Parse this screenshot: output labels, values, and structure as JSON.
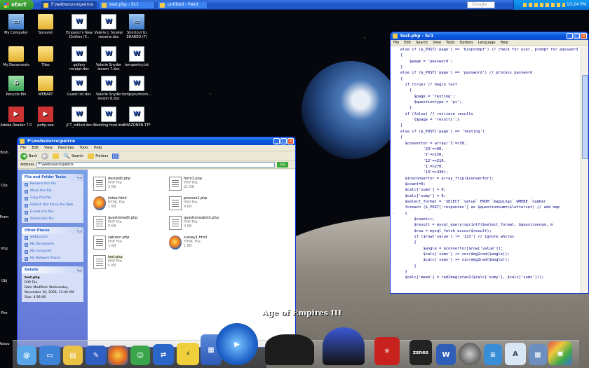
{
  "taskbar": {
    "start_label": "start",
    "tasks": [
      {
        "label": "F:\\websource\\peirce",
        "active": true
      },
      {
        "label": "test.php - Sc1",
        "active": false
      },
      {
        "label": "untitled - Paint",
        "active": false
      }
    ],
    "search_placeholder": "Google",
    "clock": "10:24 PM"
  },
  "desktop_icons": [
    {
      "label": "My Computer",
      "type": "comp"
    },
    {
      "label": "Spravist",
      "type": "folder"
    },
    {
      "label": "Emperor's New Clothes (F...",
      "type": "doc"
    },
    {
      "label": "Valerie J. Snyder resume.doc",
      "type": "doc"
    },
    {
      "label": "Shortcut to SHARED (F)",
      "type": "comp"
    },
    {
      "label": "My Documents",
      "type": "folder"
    },
    {
      "label": "Tiles",
      "type": "folder"
    },
    {
      "label": "gallery receipt.doc",
      "type": "doc"
    },
    {
      "label": "Valerie Snyder lesson 7.doc",
      "type": "doc"
    },
    {
      "label": "tempentry.txt",
      "type": "doc"
    },
    {
      "label": "Recycle Bin",
      "type": "bin"
    },
    {
      "label": "WEBART",
      "type": "folder"
    },
    {
      "label": "Guest list.doc",
      "type": "doc"
    },
    {
      "label": "Valerie Snyder lesson 8.doc",
      "type": "doc"
    },
    {
      "label": "tempyourmom...",
      "type": "doc"
    },
    {
      "label": "Adobe Reader 7.0",
      "type": "app"
    },
    {
      "label": "poftp.exe",
      "type": "app"
    },
    {
      "label": "JCT_edited.doc",
      "type": "doc"
    },
    {
      "label": "Wedding food.doc",
      "type": "doc"
    },
    {
      "label": "AMAZONEN.TTF",
      "type": "doc"
    }
  ],
  "left_edge_labels": [
    "Brsh",
    "Clip",
    "Fram",
    "Img",
    "Obj",
    "Pho",
    "Resou"
  ],
  "explorer": {
    "title": "F:\\websource\\peirce",
    "menu": [
      "File",
      "Edit",
      "View",
      "Favorites",
      "Tools",
      "Help"
    ],
    "toolbar": {
      "back": "Back",
      "search": "Search",
      "folders": "Folders"
    },
    "address_label": "Address",
    "address_value": "F:\\websource\\peirce",
    "go_label": "Go",
    "tasks_panel": {
      "title": "File and Folder Tasks",
      "items": [
        "Rename this file",
        "Move this file",
        "Copy this file",
        "Publish this file to the Web",
        "E-mail this file",
        "Delete this file"
      ]
    },
    "places_panel": {
      "title": "Other Places",
      "items": [
        "websource",
        "My Documents",
        "My Computer",
        "My Network Places"
      ]
    },
    "details_panel": {
      "title": "Details",
      "name": "test.php",
      "type": "PHP File",
      "modified": "Date Modified: Wednesday, November 30, 2005, 11:40 AM",
      "size": "Size: 4.96 KB"
    },
    "files": [
      {
        "name": "descedit.php",
        "type": "PHP File",
        "size": "2 KB",
        "icon": "doc"
      },
      {
        "name": "form1.php",
        "type": "PHP File",
        "size": "21 KB",
        "icon": "doc"
      },
      {
        "name": "index.html",
        "type": "HTML File",
        "size": "1 KB",
        "icon": "ff"
      },
      {
        "name": "process1.php",
        "type": "PHP File",
        "size": "4 KB",
        "icon": "doc"
      },
      {
        "name": "questionedit.php",
        "type": "PHP File",
        "size": "5 KB",
        "icon": "doc"
      },
      {
        "name": "questionsubmit.php",
        "type": "PHP File",
        "size": "2 KB",
        "icon": "doc"
      },
      {
        "name": "sqlconn.php",
        "type": "PHP File",
        "size": "1 KB",
        "icon": "doc"
      },
      {
        "name": "survey1.html",
        "type": "HTML File",
        "size": "1 KB",
        "icon": "ff"
      },
      {
        "name": "test.php",
        "type": "PHP File",
        "size": "5 KB",
        "icon": "doc"
      }
    ]
  },
  "editor": {
    "title": "test.php - Sc1",
    "menu": [
      "File",
      "Edit",
      "Search",
      "View",
      "Tools",
      "Options",
      "Language",
      "Help"
    ],
    "lines": [
      {
        "fold": "",
        "text": "else if ($_POST['page'] == 'bioprompt') // check for user, prompt for password"
      },
      {
        "fold": "-",
        "text": "{"
      },
      {
        "fold": "",
        "text": "    $page = 'password';"
      },
      {
        "fold": "",
        "text": ""
      },
      {
        "fold": "",
        "text": "}"
      },
      {
        "fold": "",
        "text": "else if ($_POST['page'] == 'password') // process password"
      },
      {
        "fold": "-",
        "text": "{"
      },
      {
        "fold": "",
        "text": "  if (true) // begin test"
      },
      {
        "fold": "-",
        "text": "    {"
      },
      {
        "fold": "",
        "text": "      $page = 'testing';"
      },
      {
        "fold": "",
        "text": "      $questiontype = 'pi';"
      },
      {
        "fold": "",
        "text": "    }"
      },
      {
        "fold": "",
        "text": "  if (false) // retrieve results"
      },
      {
        "fold": "",
        "text": "      {$page = 'results';}"
      },
      {
        "fold": "",
        "text": "}"
      },
      {
        "fold": "",
        "text": "else if ($_POST['page'] == 'testing')"
      },
      {
        "fold": "-",
        "text": "{"
      },
      {
        "fold": "",
        "text": "  $convertor = array('3'=>30,"
      },
      {
        "fold": "",
        "text": "          '23'=>90,"
      },
      {
        "fold": "",
        "text": "          '2'=>150,"
      },
      {
        "fold": "",
        "text": "          '12'=>210,"
      },
      {
        "fold": "",
        "text": "          '1'=>270,"
      },
      {
        "fold": "",
        "text": "          '13'=>330);"
      },
      {
        "fold": "",
        "text": "  $invconvertor = array_flip($convertor);"
      },
      {
        "fold": "",
        "text": "  $count=0;"
      },
      {
        "fold": "",
        "text": "  $calc['sumx'] = 0;"
      },
      {
        "fold": "",
        "text": "  $calc['sumy'] = 0;"
      },
      {
        "fold": "",
        "text": ""
      },
      {
        "fold": "",
        "text": "  $select_format = 'SELECT `value` FROM `mappings` WHERE `number"
      },
      {
        "fold": "",
        "text": ""
      },
      {
        "fold": "",
        "text": "  foreach ($_POST['responses'] as $questionnum=>$letterset) // add map"
      },
      {
        "fold": "-",
        "text": "  {"
      },
      {
        "fold": "",
        "text": "      $count++;"
      },
      {
        "fold": "",
        "text": "      $result = mysql_query(sprintf($select_format, $questionnum, m"
      },
      {
        "fold": "",
        "text": "      $row = mysql_fetch_assoc($result);"
      },
      {
        "fold": "",
        "text": "      if ($row['value'] != '123') // ignore whites"
      },
      {
        "fold": "-",
        "text": "      {"
      },
      {
        "fold": "",
        "text": "          $angle = $convertor[$row['value']];"
      },
      {
        "fold": "",
        "text": "          $calc['sumx'] += cos(deg2rad($angle));"
      },
      {
        "fold": "",
        "text": "          $calc['sumy'] += sin(deg2rad($angle));"
      },
      {
        "fold": "",
        "text": "      }"
      },
      {
        "fold": "",
        "text": "  }"
      },
      {
        "fold": "",
        "text": ""
      },
      {
        "fold": "",
        "text": "  $calc['mean'] = rad2deg(atan2($calc['sumy'], $calc['sumx']));"
      }
    ]
  },
  "dock": {
    "caption": "Age of Empires III",
    "label_zsnes": "zsnes"
  }
}
